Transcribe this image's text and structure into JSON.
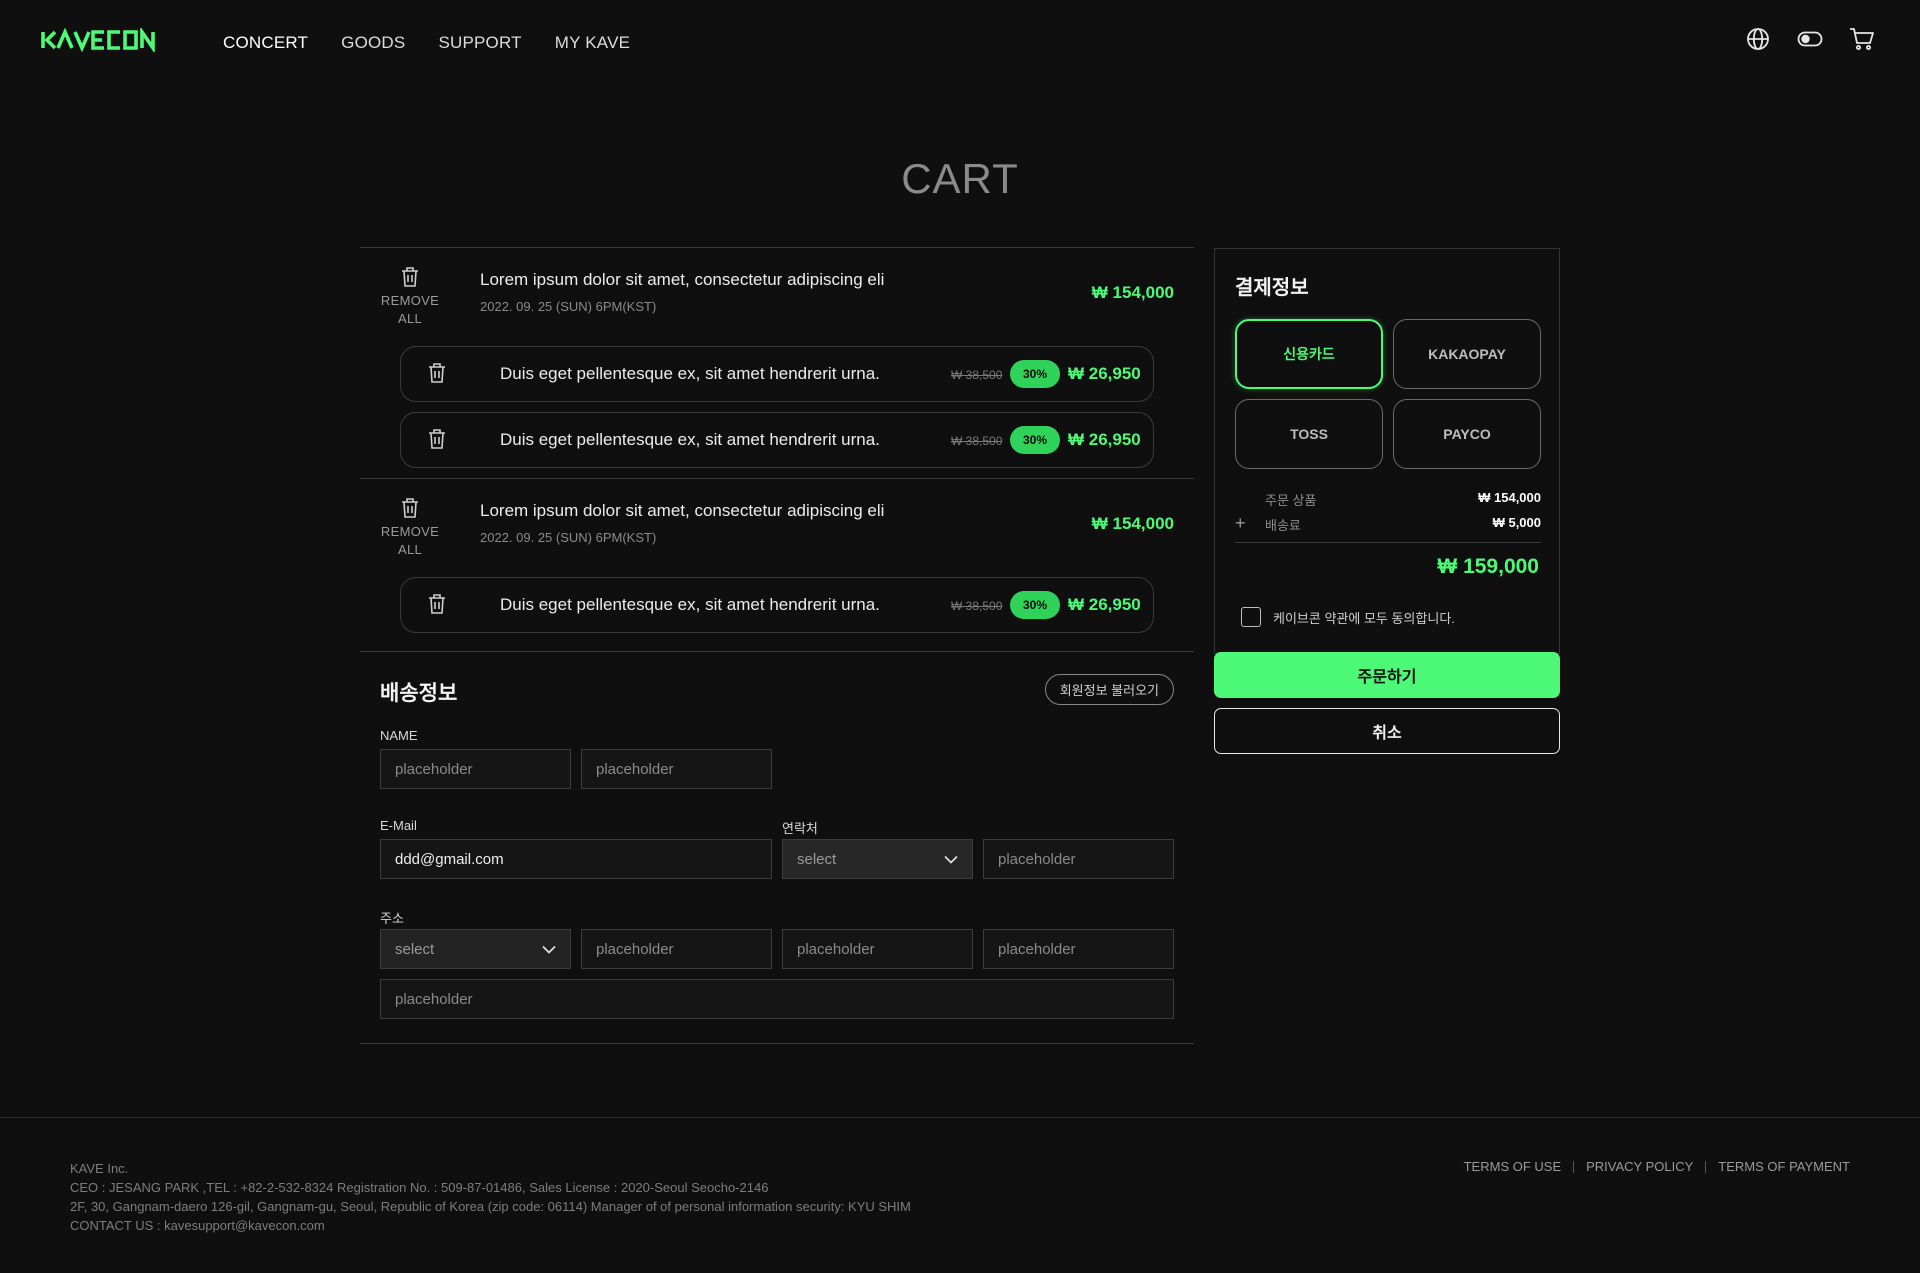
{
  "brand": {
    "logo_text": "KAVECON",
    "accent": "#4dfa78"
  },
  "nav": [
    "CONCERT",
    "GOODS",
    "SUPPORT",
    "MY KAVE"
  ],
  "header_icons": [
    "globe-icon",
    "toggle-icon",
    "cart-icon"
  ],
  "page_title": "CART",
  "cart": {
    "remove_all_label": "REMOVE ALL",
    "concerts": [
      {
        "title": "Lorem ipsum dolor sit amet, consectetur adipiscing eli",
        "date": "2022. 09. 25 (SUN) 6PM(KST)",
        "price": "₩ 154,000",
        "goods": [
          {
            "title": "Duis eget pellentesque ex, sit amet hendrerit urna.",
            "old_price": "₩ 38,500",
            "discount": "30%",
            "price": "₩ 26,950"
          },
          {
            "title": "Duis eget pellentesque ex, sit amet hendrerit urna.",
            "old_price": "₩ 38,500",
            "discount": "30%",
            "price": "₩ 26,950"
          }
        ]
      },
      {
        "title": "Lorem ipsum dolor sit amet, consectetur adipiscing eli",
        "date": "2022. 09. 25 (SUN) 6PM(KST)",
        "price": "₩ 154,000",
        "goods": [
          {
            "title": "Duis eget pellentesque ex, sit amet hendrerit urna.",
            "old_price": "₩ 38,500",
            "discount": "30%",
            "price": "₩ 26,950"
          }
        ]
      }
    ]
  },
  "shipping": {
    "title": "배송정보",
    "member_button": "회원정보 불러오기",
    "name_label": "NAME",
    "email_label": "E-Mail",
    "phone_label": "연락처",
    "address_label": "주소",
    "placeholder": "placeholder",
    "select": "select",
    "email_value": "ddd@gmail.com"
  },
  "payment": {
    "title": "결제정보",
    "methods": [
      "신용카드",
      "KAKAOPAY",
      "TOSS",
      "PAYCO"
    ],
    "selected_method": "신용카드",
    "order_items_label": "주문 상품",
    "order_items_value": "₩ 154,000",
    "shipping_fee_label": "배송료",
    "shipping_fee_value": "₩ 5,000",
    "plus": "+",
    "total": "₩ 159,000",
    "agree_text": "케이브콘 약관에 모두 동의합니다.",
    "order_button": "주문하기",
    "cancel_button": "취소"
  },
  "footer": {
    "company": "KAVE Inc.",
    "line1": "CEO : JESANG PARK ,TEL : +82-2-532-8324 Registration No. : 509-87-01486, Sales License : 2020-Seoul Seocho-2146",
    "line2": "2F, 30, Gangnam-daero 126-gil, Gangnam-gu, Seoul, Republic of Korea (zip code: 06114) Manager of of personal information security: KYU SHIM",
    "line3": "CONTACT US : kavesupport@kavecon.com",
    "links": [
      "TERMS OF USE",
      "PRIVACY POLICY",
      "TERMS OF PAYMENT"
    ]
  }
}
